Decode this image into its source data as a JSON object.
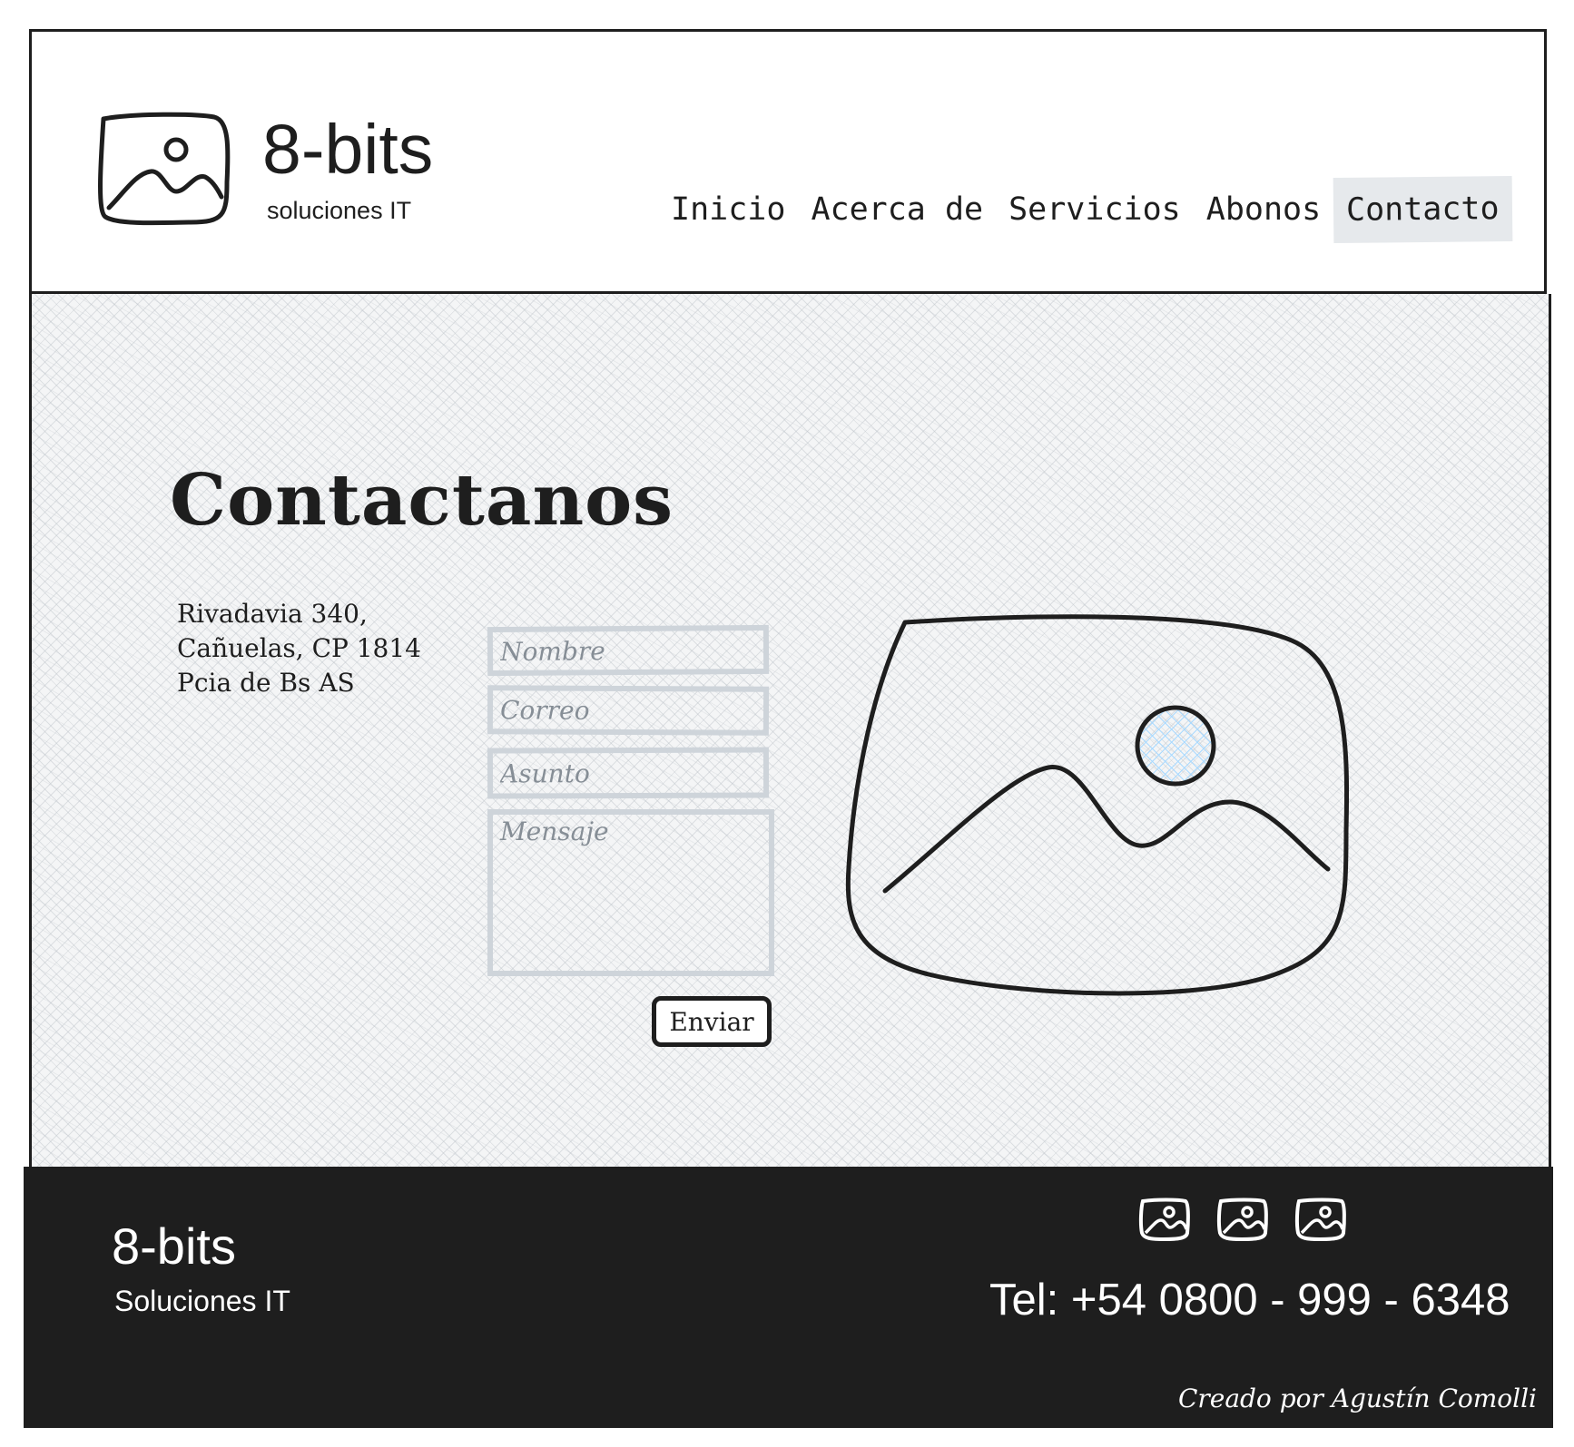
{
  "header": {
    "brand": "8-bits",
    "tagline": "soluciones IT",
    "logo_icon": "image-icon",
    "nav": [
      {
        "label": "Inicio",
        "active": false
      },
      {
        "label": "Acerca de",
        "active": false
      },
      {
        "label": "Servicios",
        "active": false
      },
      {
        "label": "Abonos",
        "active": false
      },
      {
        "label": "Contacto",
        "active": true
      }
    ]
  },
  "main": {
    "title": "Contactanos",
    "address": [
      "Rivadavia 340,",
      "Cañuelas, CP 1814",
      "Pcia de Bs AS"
    ],
    "form": {
      "name_placeholder": "Nombre",
      "email_placeholder": "Correo",
      "subject_placeholder": "Asunto",
      "message_placeholder": "Mensaje",
      "submit_label": "Enviar"
    },
    "image_icon": "image-icon"
  },
  "footer": {
    "brand": "8-bits",
    "tagline": "Soluciones IT",
    "social_icons": [
      "image-icon",
      "image-icon",
      "image-icon"
    ],
    "phone": "Tel: +54 0800 - 999 - 6348",
    "credit": "Creado por Agustín Comolli"
  },
  "colors": {
    "ink": "#1e1e1e",
    "nav_active_bg": "#e6e9ec",
    "field_border": "#ced4da",
    "placeholder": "#868e96",
    "image_sun_fill": "#a5d8ff",
    "footer_bg": "#1e1e1e"
  }
}
